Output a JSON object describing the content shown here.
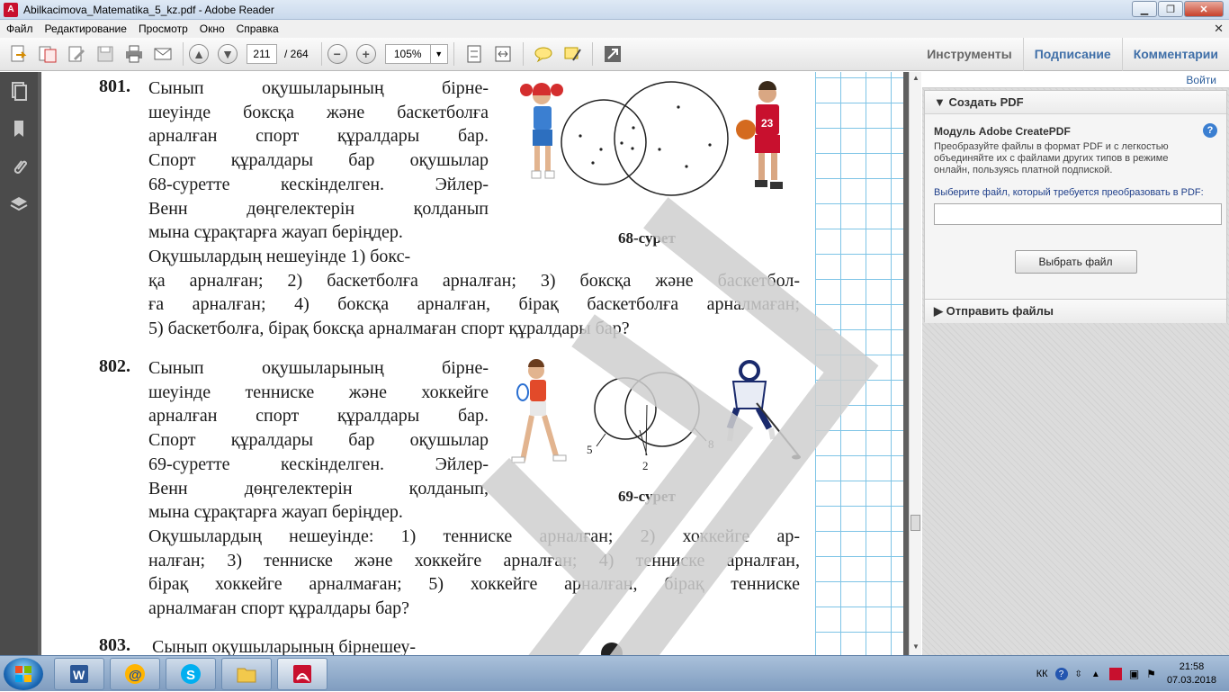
{
  "window": {
    "title": "Abilkacimova_Matematika_5_kz.pdf - Adobe Reader",
    "minimize": "▁",
    "restore": "❐",
    "close": "✕"
  },
  "menu": [
    "Файл",
    "Редактирование",
    "Просмотр",
    "Окно",
    "Справка"
  ],
  "toolbar": {
    "page_current": "211",
    "page_total": "/ 264",
    "zoom": "105%",
    "tools_label": "Инструменты",
    "sign_label": "Подписание",
    "comment_label": "Комментарии"
  },
  "document": {
    "ex801": {
      "number": "801.",
      "lines": [
        "Сынып оқушыларының бірне-",
        "шеуінде боксқа және баскетболға",
        "арналған спорт құралдары бар.",
        "Спорт құралдары бар оқушылар",
        "68-суретте кескінделген. Эйлер-",
        "Венн дөңгелектерін қолданып",
        "мына сұрақтарға жауап беріңдер."
      ],
      "full_lines": [
        "Оқушылардың нешеуінде 1) бокс-",
        "қа арналған; 2) баскетболға арналған; 3) боксқа және баскетбол-",
        "ға арналған; 4) боксқа арналған, бірақ баскетболға арналмаған;",
        "5) баскетболға, бірақ боксқа арналмаған спорт құралдары бар?"
      ],
      "caption": "68-сурет"
    },
    "ex802": {
      "number": "802.",
      "lines": [
        "Сынып оқушыларының бірне-",
        "шеуінде тенниске және хоккейге",
        "арналған спорт құралдары бар.",
        "Спорт құралдары бар оқушылар",
        "69-суретте кескінделген. Эйлер-",
        "Венн дөңгелектерін қолданып,",
        "мына сұрақтарға жауап беріңдер."
      ],
      "full_lines": [
        "Оқушылардың нешеуінде: 1) тенниске арналған; 2) хоккейге ар-",
        "налған; 3) тенниске және хоккейге арналған; 4) тенниске арналған,",
        "бірақ хоккейге арналмаған; 5) хоккейге арналған, бірақ тенниске",
        "арналмаған спорт құралдары бар?"
      ],
      "caption": "69-сурет",
      "venn_labels": [
        "5",
        "2",
        "8"
      ]
    },
    "ex803": {
      "number": "803.",
      "line": "Сынып оқушыларының бірнешеу-"
    }
  },
  "right_panel": {
    "signin": "Войти",
    "create_pdf_header": "Создать PDF",
    "module_title": "Модуль Adobe CreatePDF",
    "module_desc": "Преобразуйте файлы в формат PDF и с легкостью объединяйте их с файлами других типов в режиме онлайн, пользуясь платной подпиской.",
    "select_prompt": "Выберите файл, который требуется преобразовать в PDF:",
    "select_button": "Выбрать файл",
    "send_files_header": "Отправить файлы"
  },
  "taskbar": {
    "lang": "КК",
    "time": "21:58",
    "date": "07.03.2018"
  },
  "colors": {
    "accent_blue": "#3f6fa8",
    "grid_blue": "#7ec4e6",
    "nav_dark": "#4b4b4b"
  }
}
